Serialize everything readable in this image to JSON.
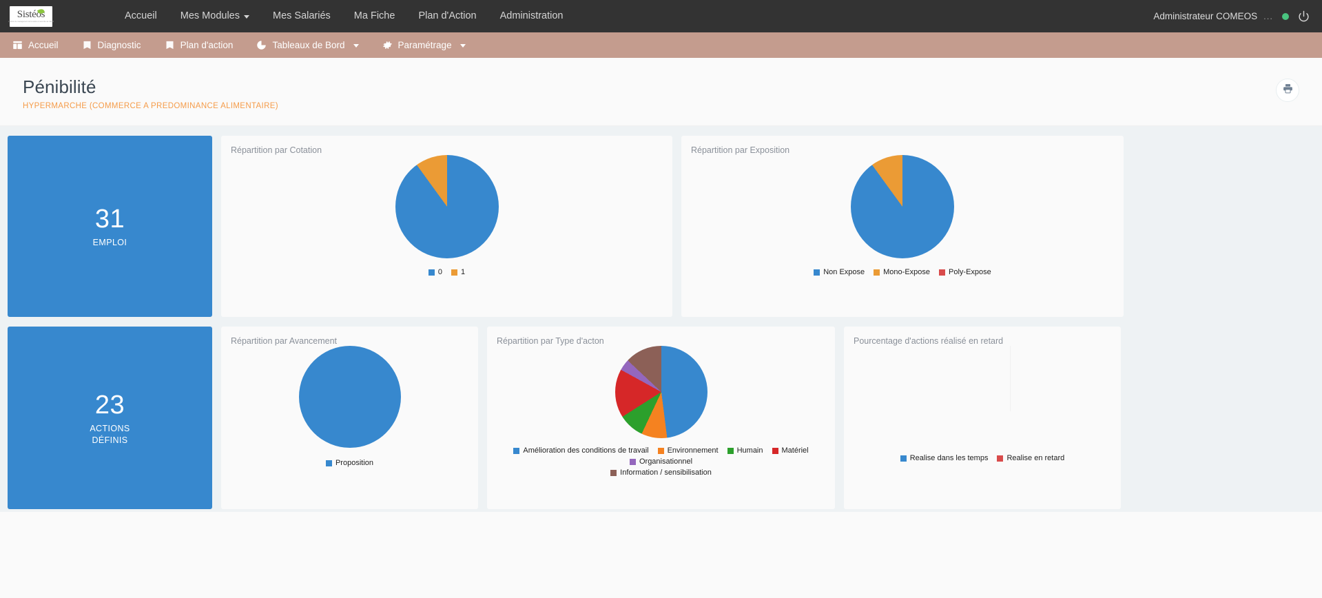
{
  "brand": {
    "logo_text": "Sistéos",
    "logo_tagline": "solution de management de la santé et sécurité au travail",
    "accent_blue": "#3788ce",
    "accent_orange": "#f59c4a",
    "subnav_bg": "#c49c8e",
    "topnav_bg": "#333333"
  },
  "topnav": {
    "items": [
      {
        "label": "Accueil",
        "has_caret": false
      },
      {
        "label": "Mes Modules",
        "has_caret": true
      },
      {
        "label": "Mes Salariés",
        "has_caret": false
      },
      {
        "label": "Ma Fiche",
        "has_caret": false
      },
      {
        "label": "Plan d'Action",
        "has_caret": false
      },
      {
        "label": "Administration",
        "has_caret": false
      }
    ],
    "user_label": "Administrateur COMEOS",
    "user_ellipsis": "...",
    "status_color": "#49c47f",
    "power_icon": "power-icon"
  },
  "subnav": {
    "items": [
      {
        "label": "Accueil",
        "icon": "dashboard-icon",
        "has_caret": false
      },
      {
        "label": "Diagnostic",
        "icon": "book-icon",
        "has_caret": false
      },
      {
        "label": "Plan d'action",
        "icon": "book-icon",
        "has_caret": false
      },
      {
        "label": "Tableaux de Bord",
        "icon": "pie-chart-icon",
        "has_caret": true
      },
      {
        "label": "Paramétrage",
        "icon": "gear-icon",
        "has_caret": true
      }
    ]
  },
  "page": {
    "title": "Pénibilité",
    "subtitle": "HYPERMARCHE (COMMERCE A PREDOMINANCE ALIMENTAIRE)",
    "print_icon": "printer-icon"
  },
  "kpis": [
    {
      "value": "31",
      "label": "EMPLOI"
    },
    {
      "value": "23",
      "label": "ACTIONS\nDÉFINIS",
      "label_line1": "ACTIONS",
      "label_line2": "DÉFINIS"
    }
  ],
  "chart_data": [
    {
      "id": "cotation",
      "type": "pie",
      "title": "Répartition par Cotation",
      "categories": [
        "0",
        "1"
      ],
      "values": [
        90,
        10
      ],
      "colors": [
        "#3788ce",
        "#eb9b35"
      ],
      "legend_position": "bottom",
      "start_angle": 0
    },
    {
      "id": "exposition",
      "type": "pie",
      "title": "Répartition par Exposition",
      "categories": [
        "Non Expose",
        "Mono-Expose",
        "Poly-Expose"
      ],
      "values": [
        90,
        10,
        0
      ],
      "colors": [
        "#3788ce",
        "#eb9b35",
        "#d94b4b"
      ],
      "legend_position": "bottom",
      "start_angle": 0
    },
    {
      "id": "avancement",
      "type": "pie",
      "title": "Répartition par Avancement",
      "categories": [
        "Proposition"
      ],
      "values": [
        100
      ],
      "colors": [
        "#3788ce"
      ],
      "legend_position": "bottom",
      "start_angle": 0
    },
    {
      "id": "type-action",
      "type": "pie",
      "title": "Répartition par Type d'acton",
      "categories": [
        "Amélioration des conditions de travail",
        "Environnement",
        "Humain",
        "Matériel",
        "Organisationnel",
        "Information / sensibilisation"
      ],
      "values": [
        48,
        9,
        9,
        17,
        4,
        13
      ],
      "colors": [
        "#3788ce",
        "#f58220",
        "#2ca02c",
        "#d62728",
        "#9467bd",
        "#8c6057"
      ],
      "legend_position": "bottom",
      "start_angle": 0
    },
    {
      "id": "retard",
      "type": "pie",
      "title": "Pourcentage d'actions réalisé en retard",
      "categories": [
        "Realise dans les temps",
        "Realise en retard"
      ],
      "values": [
        0,
        0
      ],
      "colors": [
        "#3788ce",
        "#d94b4b"
      ],
      "legend_position": "bottom",
      "empty": true
    }
  ]
}
